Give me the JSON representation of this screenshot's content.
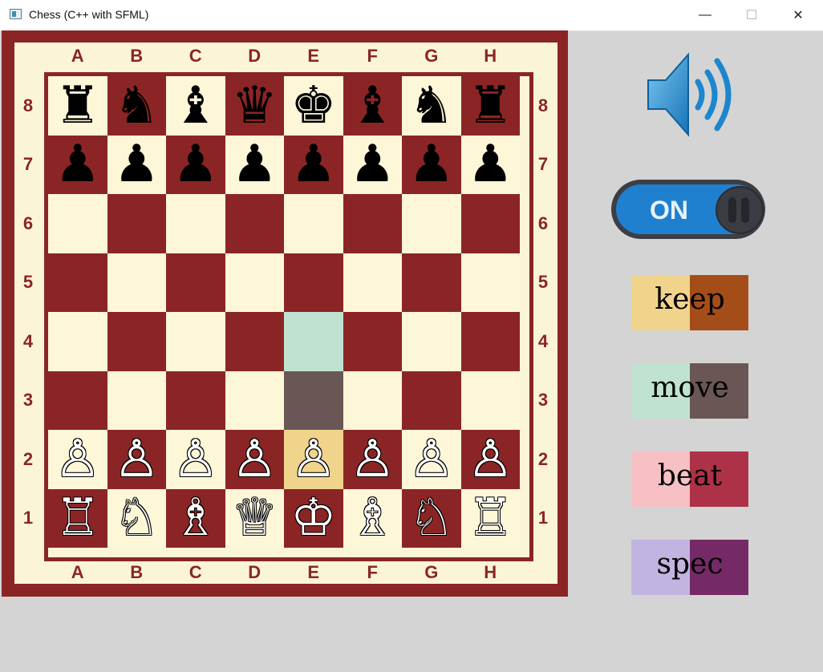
{
  "window": {
    "title": "Chess (C++ with SFML)",
    "minimize_glyph": "—",
    "maximize_glyph": "☐",
    "close_glyph": "✕"
  },
  "board": {
    "files": [
      "A",
      "B",
      "C",
      "D",
      "E",
      "F",
      "G",
      "H"
    ],
    "ranks": [
      "8",
      "7",
      "6",
      "5",
      "4",
      "3",
      "2",
      "1"
    ],
    "colors": {
      "dark": "#8b2525",
      "light": "#fdf7d8",
      "highlight_keep": "#f0d48c",
      "highlight_move_light": "#bfe3d0",
      "highlight_move_dark": "#6b5656"
    },
    "rows": [
      [
        "♜",
        "♞",
        "♝",
        "♛",
        "♚",
        "♝",
        "♞",
        "♜"
      ],
      [
        "♟",
        "♟",
        "♟",
        "♟",
        "♟",
        "♟",
        "♟",
        "♟"
      ],
      [
        "",
        "",
        "",
        "",
        "",
        "",
        "",
        ""
      ],
      [
        "",
        "",
        "",
        "",
        "",
        "",
        "",
        ""
      ],
      [
        "",
        "",
        "",
        "",
        "",
        "",
        "",
        ""
      ],
      [
        "",
        "",
        "",
        "",
        "",
        "",
        "",
        ""
      ],
      [
        "♙",
        "♙",
        "♙",
        "♙",
        "♙",
        "♙",
        "♙",
        "♙"
      ],
      [
        "♖",
        "♘",
        "♗",
        "♕",
        "♔",
        "♗",
        "♘",
        "♖"
      ]
    ],
    "highlights": [
      {
        "square": "e2",
        "type": "keep"
      },
      {
        "square": "e3",
        "type": "move"
      },
      {
        "square": "e4",
        "type": "move"
      }
    ]
  },
  "controls": {
    "sound_icon": "speaker-icon",
    "toggle_label": "ON"
  },
  "legend": [
    {
      "label": "keep",
      "light": "#f0d48c",
      "dark": "#a54d19"
    },
    {
      "label": "move",
      "light": "#bfe3d0",
      "dark": "#6b5656"
    },
    {
      "label": "beat",
      "light": "#f7c0c4",
      "dark": "#ad3248"
    },
    {
      "label": "spec",
      "light": "#c2b4e0",
      "dark": "#752a67"
    }
  ]
}
